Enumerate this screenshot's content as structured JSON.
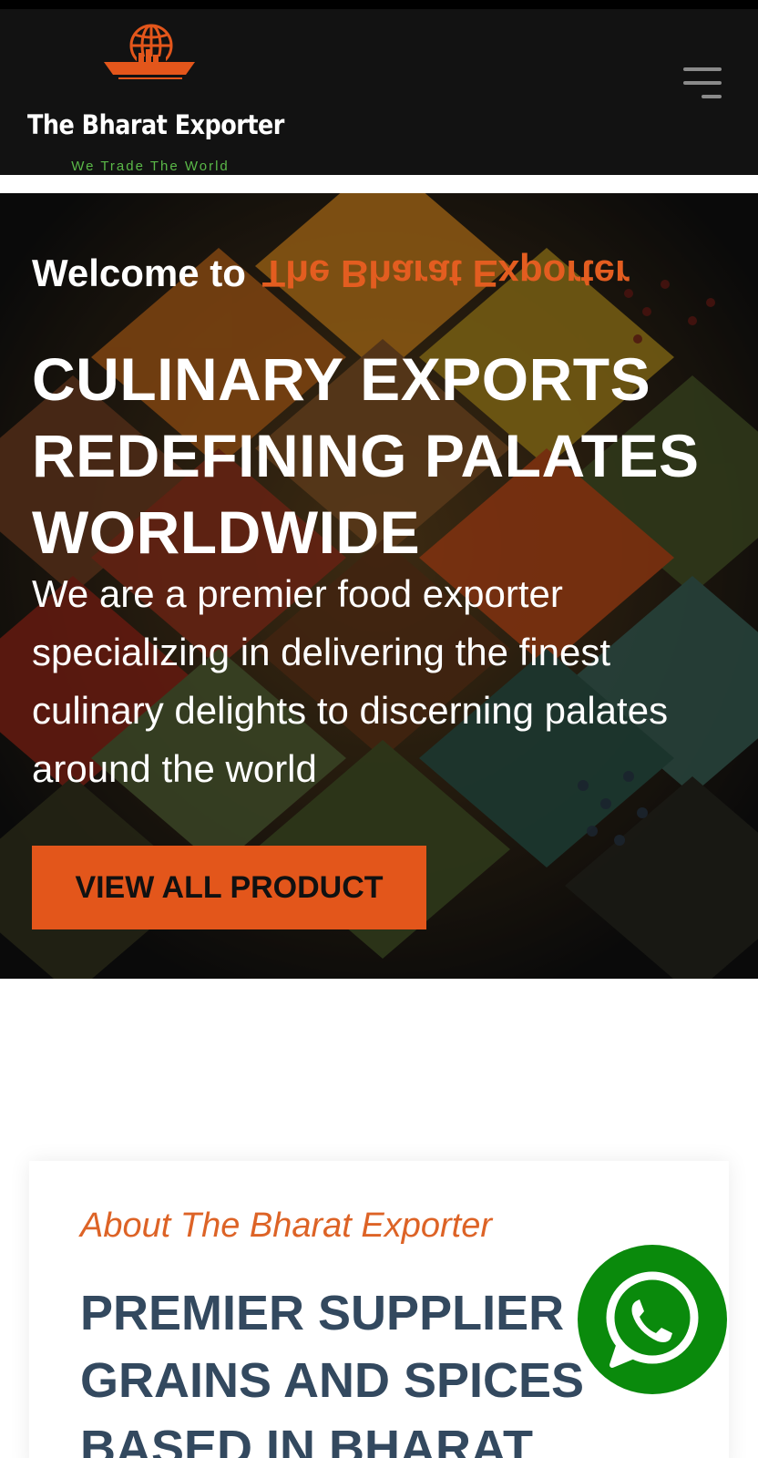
{
  "header": {
    "brand_name": "The Bharat Exporter",
    "tagline": "We Trade The World",
    "menu_icon": "hamburger-menu-icon",
    "logo_icon": "globe-ship-icon"
  },
  "hero": {
    "welcome_prefix": "Welcome to",
    "welcome_brand": "The Bharat Exporter",
    "headline": "CULINARY EXPORTS REDEFINING PALATES WORLDWIDE",
    "description": "We are a premier food exporter specializing in delivering the finest culinary delights to discerning palates around the world",
    "cta_label": "VIEW ALL PRODUCT",
    "background": "spices-background-image"
  },
  "about": {
    "kicker": "About The Bharat Exporter",
    "title": "PREMIER SUPPLIER OF GRAINS AND SPICES BASED IN BHARAT"
  },
  "floating": {
    "whatsapp_icon": "whatsapp-icon"
  },
  "colors": {
    "accent_orange": "#e3561b",
    "header_bg": "#121212",
    "tagline_green": "#5ab848",
    "about_title": "#33495f",
    "whatsapp_green": "#0a8a0c"
  }
}
